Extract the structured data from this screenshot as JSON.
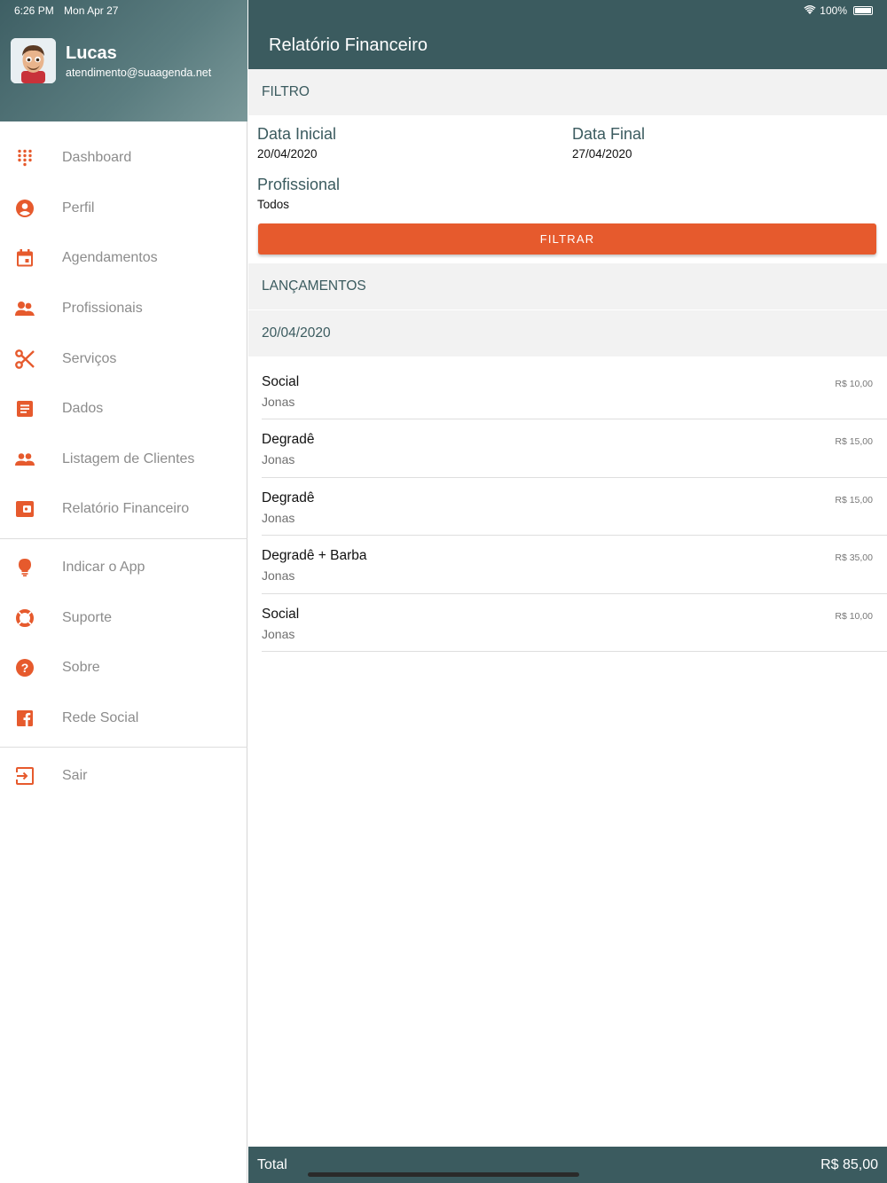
{
  "status": {
    "time": "6:26 PM",
    "date": "Mon Apr 27",
    "battery": "100%"
  },
  "user": {
    "name": "Lucas",
    "email": "atendimento@suaagenda.net"
  },
  "menu": {
    "primary": [
      {
        "label": "Dashboard",
        "icon": "dialpad-icon"
      },
      {
        "label": "Perfil",
        "icon": "account-circle-icon"
      },
      {
        "label": "Agendamentos",
        "icon": "calendar-icon"
      },
      {
        "label": "Profissionais",
        "icon": "professionals-icon"
      },
      {
        "label": "Serviços",
        "icon": "scissors-icon"
      },
      {
        "label": "Dados",
        "icon": "document-icon"
      },
      {
        "label": "Listagem de Clientes",
        "icon": "people-icon"
      },
      {
        "label": "Relatório Financeiro",
        "icon": "wallet-icon"
      }
    ],
    "secondary": [
      {
        "label": "Indicar o App",
        "icon": "lightbulb-icon"
      },
      {
        "label": "Suporte",
        "icon": "lifebuoy-icon"
      },
      {
        "label": "Sobre",
        "icon": "help-icon"
      },
      {
        "label": "Rede Social",
        "icon": "facebook-icon"
      }
    ],
    "logout": {
      "label": "Sair",
      "icon": "exit-icon"
    }
  },
  "header": {
    "title": "Relatório Financeiro"
  },
  "filter": {
    "section_title": "FILTRO",
    "start_label": "Data Inicial",
    "start_value": "20/04/2020",
    "end_label": "Data Final",
    "end_value": "27/04/2020",
    "professional_label": "Profissional",
    "professional_value": "Todos",
    "button_label": "FILTRAR"
  },
  "entries_section": {
    "title": "LANÇAMENTOS",
    "date_group": "20/04/2020",
    "items": [
      {
        "service": "Social",
        "professional": "Jonas",
        "amount": "R$  10,00"
      },
      {
        "service": "Degradê",
        "professional": "Jonas",
        "amount": "R$  15,00"
      },
      {
        "service": "Degradê",
        "professional": "Jonas",
        "amount": "R$  15,00"
      },
      {
        "service": "Degradê + Barba",
        "professional": "Jonas",
        "amount": "R$  35,00"
      },
      {
        "service": "Social",
        "professional": "Jonas",
        "amount": "R$  10,00"
      }
    ]
  },
  "footer": {
    "total_label": "Total",
    "total_value": "R$  85,00"
  },
  "colors": {
    "accent": "#e65a2d",
    "header": "#3b5b5f",
    "section_bg": "#f2f2f2"
  }
}
